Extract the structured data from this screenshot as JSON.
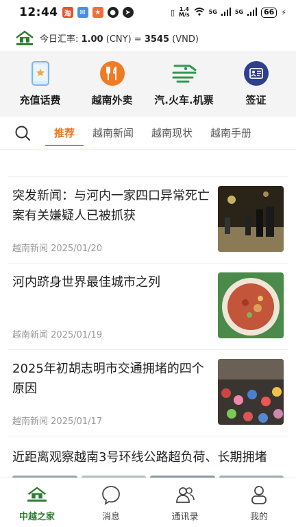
{
  "status": {
    "time": "12:44",
    "net1": "5G",
    "net2": "5G",
    "speed": "1.4",
    "speed_unit": "M/s",
    "battery": "66"
  },
  "rate": {
    "prefix": "今日汇率:",
    "cny_value": "1.00",
    "cny_unit": "(CNY)",
    "equals": "=",
    "vnd_value": "3545",
    "vnd_unit": "(VND)"
  },
  "services": [
    {
      "label": "充值话费",
      "icon": "phone-recharge-icon"
    },
    {
      "label": "越南外卖",
      "icon": "food-delivery-icon"
    },
    {
      "label": "汽.火车.机票",
      "icon": "train-ticket-icon"
    },
    {
      "label": "签证",
      "icon": "visa-icon"
    }
  ],
  "tabs": [
    {
      "label": "推荐",
      "active": true
    },
    {
      "label": "越南新闻"
    },
    {
      "label": "越南现状"
    },
    {
      "label": "越南手册"
    }
  ],
  "news": [
    {
      "title": "突发新闻：与河内一家四口异常死亡案有关嫌疑人已被抓获",
      "source": "越南新闻",
      "date": "2025/01/20"
    },
    {
      "title": "河内跻身世界最佳城市之列",
      "source": "越南新闻",
      "date": "2025/01/19"
    },
    {
      "title": "2025年初胡志明市交通拥堵的四个原因",
      "source": "越南新闻",
      "date": "2025/01/17"
    },
    {
      "title": "近距离观察越南3号环线公路超负荷、长期拥堵"
    }
  ],
  "nav": [
    {
      "label": "中越之家",
      "icon": "home-logo-icon",
      "active": true
    },
    {
      "label": "消息",
      "icon": "message-icon"
    },
    {
      "label": "通讯录",
      "icon": "contacts-icon"
    },
    {
      "label": "我的",
      "icon": "profile-icon"
    }
  ],
  "colors": {
    "accent": "#e07a2a",
    "brand_green": "#2e7d32",
    "service_bg": "#f4f4f4"
  }
}
